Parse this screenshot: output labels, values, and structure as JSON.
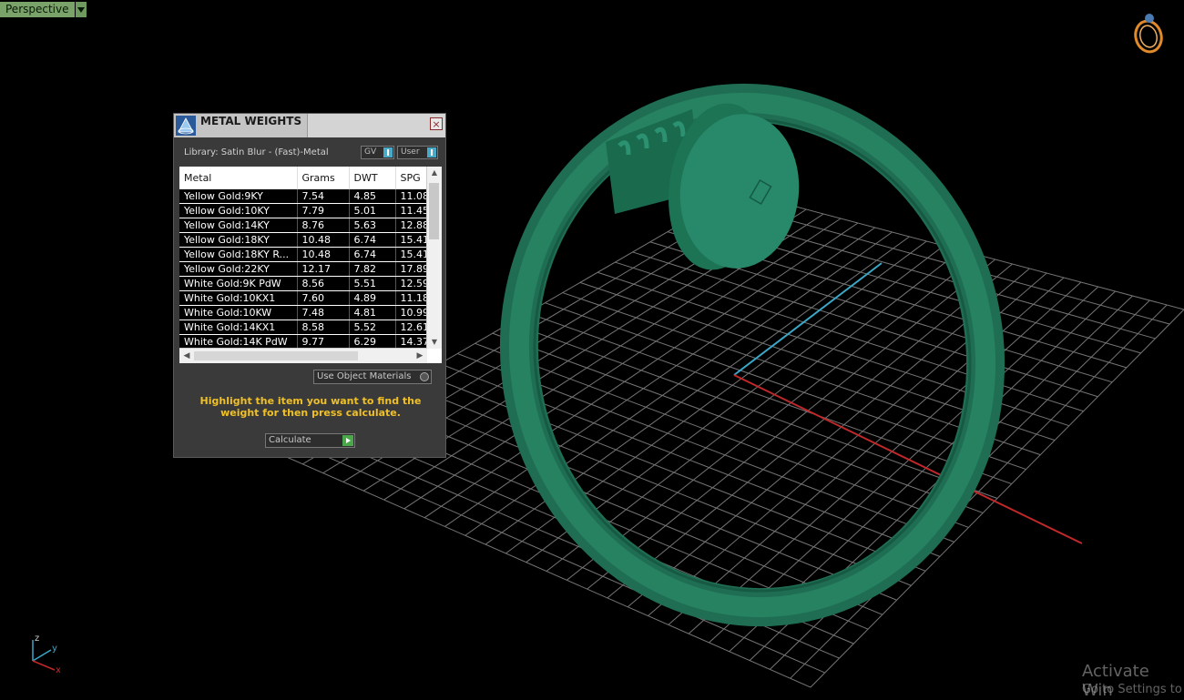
{
  "viewport": {
    "label": "Perspective",
    "axis": {
      "z": "z",
      "y": "y",
      "x": "x"
    },
    "watermark": {
      "line1": "Activate Win",
      "line2": "Go to Settings to"
    },
    "colors": {
      "ring": "#1e7a5a",
      "grid": "#8a8a8a",
      "axis_x": "#c0282a",
      "axis_y": "#3aa8c8"
    }
  },
  "panel": {
    "title": "METAL WEIGHTS",
    "close": "×",
    "library": "Library: Satin Blur - (Fast)-Metal",
    "toggle_gv": "GV",
    "toggle_user": "User",
    "columns": [
      "Metal",
      "Grams",
      "DWT",
      "SPG"
    ],
    "rows": [
      [
        "Yellow Gold:9KY",
        "7.54",
        "4.85",
        "11.08"
      ],
      [
        "Yellow Gold:10KY",
        "7.79",
        "5.01",
        "11.45"
      ],
      [
        "Yellow Gold:14KY",
        "8.76",
        "5.63",
        "12.88"
      ],
      [
        "Yellow Gold:18KY",
        "10.48",
        "6.74",
        "15.41"
      ],
      [
        "Yellow Gold:18KY R...",
        "10.48",
        "6.74",
        "15.41"
      ],
      [
        "Yellow Gold:22KY",
        "12.17",
        "7.82",
        "17.89"
      ],
      [
        "White Gold:9K PdW",
        "8.56",
        "5.51",
        "12.59"
      ],
      [
        "White Gold:10KX1",
        "7.60",
        "4.89",
        "11.18"
      ],
      [
        "White Gold:10KW",
        "7.48",
        "4.81",
        "10.99"
      ],
      [
        "White Gold:14KX1",
        "8.58",
        "5.52",
        "12.61"
      ],
      [
        "White Gold:14K PdW",
        "9.77",
        "6.29",
        "14.37"
      ]
    ],
    "use_object_materials": "Use Object Materials",
    "hint": "Highlight the item you want to find the weight for then press calculate.",
    "calculate": "Calculate"
  }
}
